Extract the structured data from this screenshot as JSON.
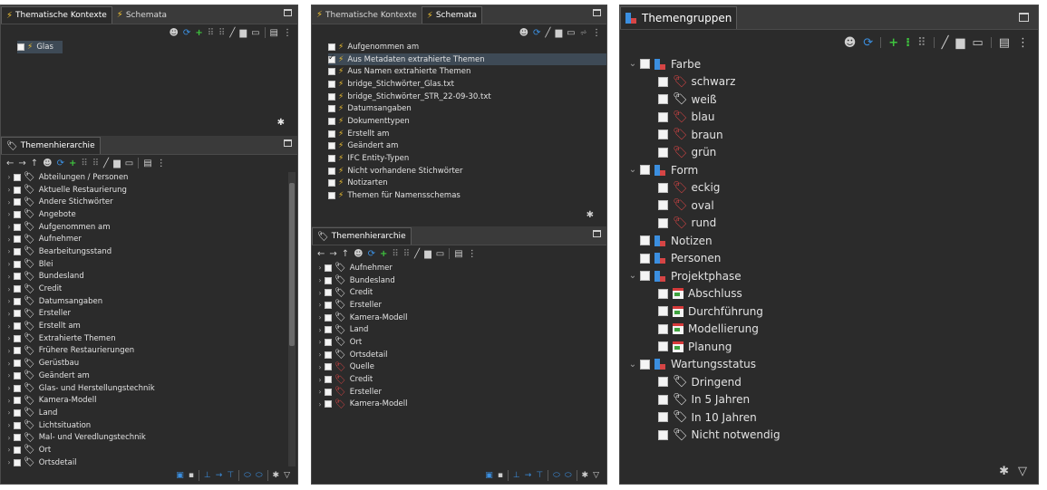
{
  "colors": {
    "panel_bg": "#2b2b2b",
    "tab_bg": "#3a3a3a",
    "tag_red": "#d64545",
    "tag_green": "#3fa33f",
    "bolt": "#f2c230",
    "blue": "#3b8fe0",
    "green": "#3ec43e"
  },
  "left": {
    "tabs": [
      "Thematische Kontexte",
      "Schemata"
    ],
    "context_items": [
      "Glas"
    ],
    "hierarchy_tab": "Themenhierarchie",
    "hierarchy_items": [
      "Abteilungen / Personen",
      "Aktuelle Restaurierung",
      "Andere Stichwörter",
      "Angebote",
      "Aufgenommen am",
      "Aufnehmer",
      "Bearbeitungsstand",
      "Blei",
      "Bundesland",
      "Credit",
      "Datumsangaben",
      "Ersteller",
      "Erstellt am",
      "Extrahierte Themen",
      "Frühere Restaurierungen",
      "Gerüstbau",
      "Geändert am",
      "Glas- und Herstellungstechnik",
      "Kamera-Modell",
      "Land",
      "Lichtsituation",
      "Mal- und Veredlungstechnik",
      "Ort",
      "Ortsdetail"
    ]
  },
  "middle": {
    "tabs": [
      "Thematische Kontexte",
      "Schemata"
    ],
    "schema_items": [
      {
        "label": "Aufgenommen am",
        "checked": false
      },
      {
        "label": "Aus Metadaten extrahierte Themen",
        "checked": true
      },
      {
        "label": "Aus Namen extrahierte Themen",
        "checked": false
      },
      {
        "label": "bridge_Stichwörter_Glas.txt",
        "checked": false
      },
      {
        "label": "bridge_Stichwörter_STR_22-09-30.txt",
        "checked": false
      },
      {
        "label": "Datumsangaben",
        "checked": false
      },
      {
        "label": "Dokumenttypen",
        "checked": false
      },
      {
        "label": "Erstellt am",
        "checked": false
      },
      {
        "label": "Geändert am",
        "checked": false
      },
      {
        "label": "IFC Entity-Typen",
        "checked": false
      },
      {
        "label": "Nicht vorhandene Stichwörter",
        "checked": false
      },
      {
        "label": "Notizarten",
        "checked": false
      },
      {
        "label": "Themen für Namensschemas",
        "checked": false
      }
    ],
    "hierarchy_tab": "Themenhierarchie",
    "hierarchy_items": [
      "Aufnehmer",
      "Bundesland",
      "Credit",
      "Ersteller",
      "Kamera-Modell",
      "Land",
      "Ort",
      "Ortsdetail",
      "Quelle",
      "Credit",
      "Ersteller",
      "Kamera-Modell"
    ]
  },
  "right": {
    "tab": "Themengruppen",
    "tree": [
      {
        "label": "Farbe",
        "type": "group",
        "level": 0
      },
      {
        "label": "schwarz",
        "type": "tag",
        "level": 1
      },
      {
        "label": "weiß",
        "type": "tag",
        "level": 1
      },
      {
        "label": "blau",
        "type": "tag",
        "level": 1
      },
      {
        "label": "braun",
        "type": "tag",
        "level": 1
      },
      {
        "label": "grün",
        "type": "tag",
        "level": 1
      },
      {
        "label": "Form",
        "type": "group",
        "level": 0
      },
      {
        "label": "eckig",
        "type": "tag",
        "level": 1
      },
      {
        "label": "oval",
        "type": "tag",
        "level": 1
      },
      {
        "label": "rund",
        "type": "tag",
        "level": 1
      },
      {
        "label": "Notizen",
        "type": "group-leaf",
        "level": 0
      },
      {
        "label": "Personen",
        "type": "group-leaf",
        "level": 0
      },
      {
        "label": "Projektphase",
        "type": "group",
        "level": 0
      },
      {
        "label": "Abschluss",
        "type": "cal",
        "level": 1
      },
      {
        "label": "Durchführung",
        "type": "cal",
        "level": 1
      },
      {
        "label": "Modellierung",
        "type": "cal",
        "level": 1
      },
      {
        "label": "Planung",
        "type": "cal",
        "level": 1
      },
      {
        "label": "Wartungsstatus",
        "type": "group",
        "level": 0
      },
      {
        "label": "Dringend",
        "type": "tag",
        "level": 1
      },
      {
        "label": "In 5 Jahren",
        "type": "tag",
        "level": 1
      },
      {
        "label": "In 10 Jahren",
        "type": "tag",
        "level": 1
      },
      {
        "label": "Nicht notwendig",
        "type": "tag",
        "level": 1
      }
    ]
  }
}
